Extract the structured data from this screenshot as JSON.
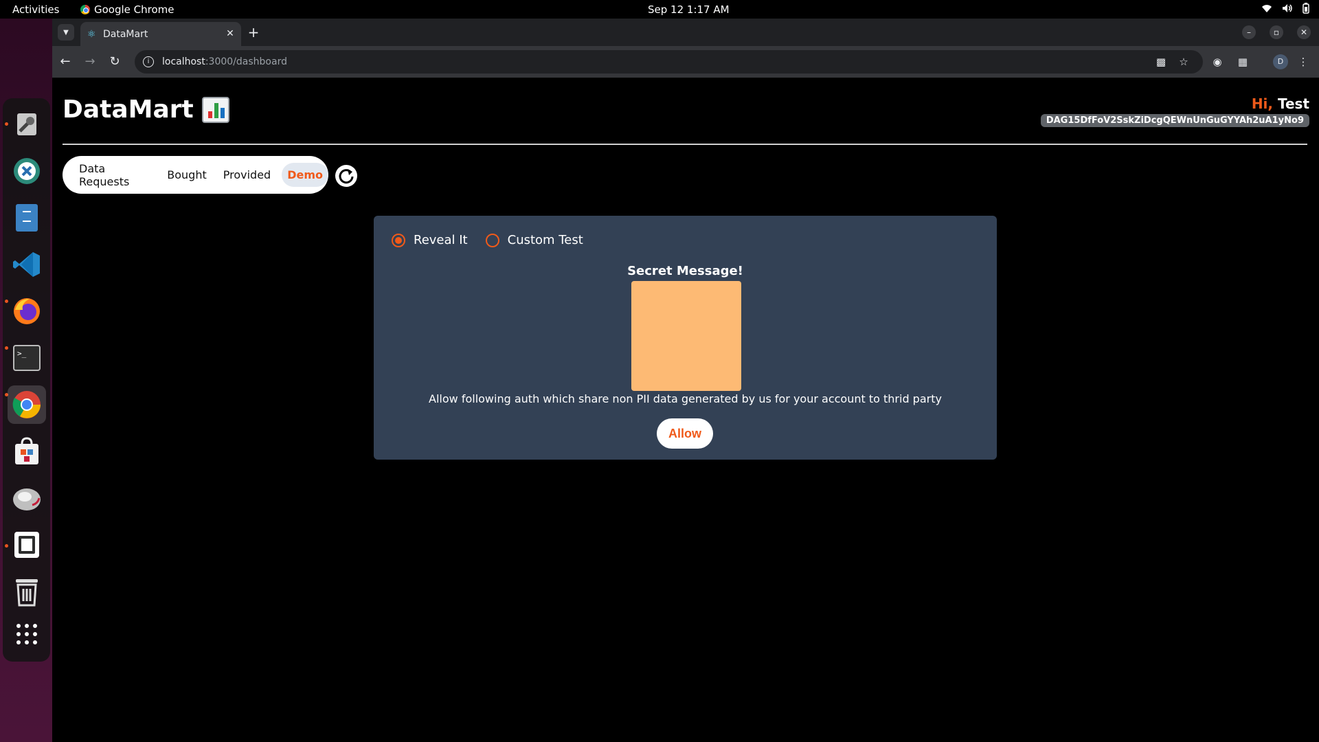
{
  "system_bar": {
    "activities": "Activities",
    "app_name": "Google Chrome",
    "clock": "Sep 12  1:17 AM"
  },
  "browser": {
    "tab_title": "DataMart",
    "url_host": "localhost",
    "url_path": ":3000/dashboard",
    "profile_initial": "D"
  },
  "header": {
    "brand": "DataMart",
    "greeting_hi": "Hi,",
    "greeting_name": "Test",
    "wallet_address": "DAG15DfFoV2SskZiDcgQEWnUnGuGYYAh2uA1yNo9"
  },
  "nav": {
    "items": [
      {
        "label": "Data Requests",
        "active": false
      },
      {
        "label": "Bought",
        "active": false
      },
      {
        "label": "Provided",
        "active": false
      },
      {
        "label": "Demo",
        "active": true
      }
    ]
  },
  "demo": {
    "options": [
      {
        "label": "Reveal It",
        "selected": true
      },
      {
        "label": "Custom Test",
        "selected": false
      }
    ],
    "secret_title": "Secret Message!",
    "secret_color": "#fdba74",
    "auth_text": "Allow following auth which share non PII data generated by us for your account to thrid party",
    "allow_label": "Allow"
  },
  "colors": {
    "accent": "#f05a1a",
    "card": "#334155"
  }
}
